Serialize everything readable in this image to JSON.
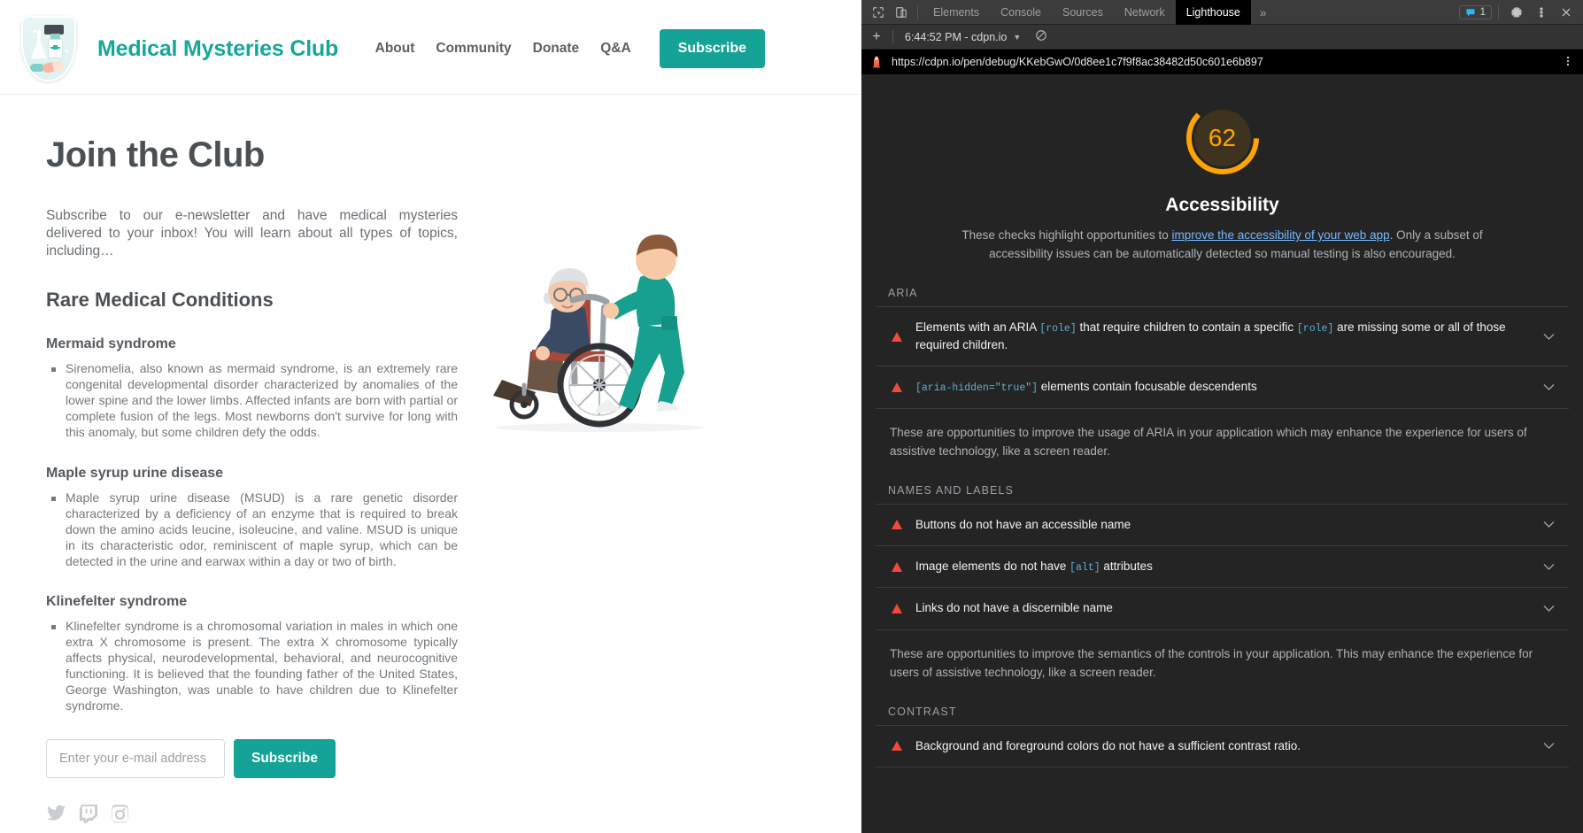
{
  "site": {
    "logo_icon": "medical-shield-badge-icon",
    "title": "Medical Mysteries Club",
    "nav": [
      {
        "label": "About"
      },
      {
        "label": "Community"
      },
      {
        "label": "Donate"
      },
      {
        "label": "Q&A"
      }
    ],
    "nav_cta": "Subscribe",
    "accent_color": "#14a396"
  },
  "main": {
    "page_title": "Join the Club",
    "intro": "Subscribe to our e-newsletter and have medical mysteries delivered to your inbox! You will learn about all types of topics, including…",
    "section_title": "Rare Medical Conditions",
    "conditions": [
      {
        "name": "Mermaid syndrome",
        "body": "Sirenomelia, also known as mermaid syndrome, is an extremely rare congenital developmental disorder characterized by anomalies of the lower spine and the lower limbs. Affected infants are born with partial or complete fusion of the legs. Most newborns don't survive for long with this anomaly, but some children defy the odds."
      },
      {
        "name": "Maple syrup urine disease",
        "body": "Maple syrup urine disease (MSUD) is a rare genetic disorder characterized by a deficiency of an enzyme that is required to break down the amino acids leucine, isoleucine, and valine. MSUD is unique in its characteristic odor, reminiscent of maple syrup, which can be detected in the urine and earwax within a day or two of birth."
      },
      {
        "name": "Klinefelter syndrome",
        "body": "Klinefelter syndrome is a chromosomal variation in males in which one extra X chromosome is present. The extra X chromosome typically affects physical, neurodevelopmental, behavioral, and neurocognitive functioning. It is believed that the founding father of the United States, George Washington, was unable to have children due to Klinefelter syndrome."
      }
    ],
    "form": {
      "email_placeholder": "Enter your e-mail address",
      "email_value": "",
      "submit_label": "Subscribe"
    },
    "socials": [
      {
        "icon": "twitter-icon"
      },
      {
        "icon": "twitch-icon"
      },
      {
        "icon": "instagram-icon"
      }
    ],
    "illustration_alt": "nurse-pushing-elderly-patient-in-wheelchair-illustration"
  },
  "devtools": {
    "toolbar": {
      "inspect_icon": "inspect-element-icon",
      "device_icon": "device-toolbar-icon",
      "tabs": [
        {
          "label": "Elements",
          "active": false
        },
        {
          "label": "Console",
          "active": false
        },
        {
          "label": "Sources",
          "active": false
        },
        {
          "label": "Network",
          "active": false
        },
        {
          "label": "Lighthouse",
          "active": true
        }
      ],
      "more_tabs": "»",
      "issues_count": "1",
      "issues_icon": "issues-message-icon",
      "settings_icon": "gear-icon",
      "menu_icon": "kebab-menu-icon",
      "close_icon": "close-icon"
    },
    "lighthouse_bar": {
      "add_icon": "plus-icon",
      "report_label": "6:44:52 PM - cdpn.io",
      "dropdown_icon": "chevron-down-icon",
      "clear_icon": "clear-all-icon"
    },
    "url_bar": {
      "favicon": "lighthouse-favicon",
      "url": "https://cdpn.io/pen/debug/KKebGwO/0d8ee1c7f9f8ac38482d50c601e6b897",
      "menu_icon": "kebab-menu-icon"
    },
    "report": {
      "score": "62",
      "score_color": "#ffa400",
      "category": "Accessibility",
      "description_pre": "These checks highlight opportunities to ",
      "description_link": "improve the accessibility of your web app",
      "description_post": ". Only a subset of accessibility issues can be automatically detected so manual testing is also encouraged.",
      "sections": [
        {
          "heading": "ARIA",
          "audits": [
            {
              "icon": "fail-triangle-icon",
              "parts": [
                {
                  "type": "text",
                  "value": "Elements with an ARIA "
                },
                {
                  "type": "code",
                  "value": "[role]"
                },
                {
                  "type": "text",
                  "value": " that require children to contain a specific "
                },
                {
                  "type": "code",
                  "value": "[role]"
                },
                {
                  "type": "text",
                  "value": " are missing some or all of those required children."
                }
              ],
              "chevron": "chevron-down-icon"
            },
            {
              "icon": "fail-triangle-icon",
              "parts": [
                {
                  "type": "code",
                  "value": "[aria-hidden=\"true\"]"
                },
                {
                  "type": "text",
                  "value": " elements contain focusable descendents"
                }
              ],
              "chevron": "chevron-down-icon"
            }
          ],
          "footer": "These are opportunities to improve the usage of ARIA in your application which may enhance the experience for users of assistive technology, like a screen reader."
        },
        {
          "heading": "NAMES AND LABELS",
          "audits": [
            {
              "icon": "fail-triangle-icon",
              "parts": [
                {
                  "type": "text",
                  "value": "Buttons do not have an accessible name"
                }
              ],
              "chevron": "chevron-down-icon"
            },
            {
              "icon": "fail-triangle-icon",
              "parts": [
                {
                  "type": "text",
                  "value": "Image elements do not have "
                },
                {
                  "type": "code",
                  "value": "[alt]"
                },
                {
                  "type": "text",
                  "value": " attributes"
                }
              ],
              "chevron": "chevron-down-icon"
            },
            {
              "icon": "fail-triangle-icon",
              "parts": [
                {
                  "type": "text",
                  "value": "Links do not have a discernible name"
                }
              ],
              "chevron": "chevron-down-icon"
            }
          ],
          "footer": "These are opportunities to improve the semantics of the controls in your application. This may enhance the experience for users of assistive technology, like a screen reader."
        },
        {
          "heading": "CONTRAST",
          "audits": [
            {
              "icon": "fail-triangle-icon",
              "parts": [
                {
                  "type": "text",
                  "value": "Background and foreground colors do not have a sufficient contrast ratio."
                }
              ],
              "chevron": "chevron-down-icon"
            }
          ],
          "footer": ""
        }
      ]
    }
  }
}
